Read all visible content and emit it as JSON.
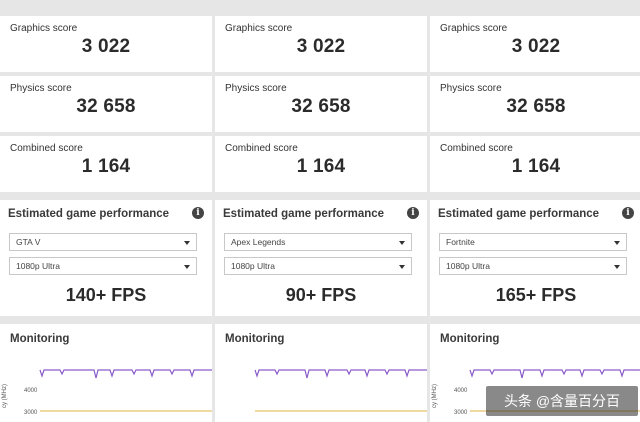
{
  "columns": [
    {
      "graphics": {
        "label": "Graphics score",
        "value": "3 022"
      },
      "physics": {
        "label": "Physics score",
        "value": "32 658"
      },
      "combined": {
        "label": "Combined score",
        "value": "1 164"
      },
      "estimated": {
        "title": "Estimated game performance",
        "game": "GTA V",
        "preset": "1080p Ultra",
        "fps": "140+ FPS"
      },
      "monitoring": {
        "title": "Monitoring"
      }
    },
    {
      "graphics": {
        "label": "Graphics score",
        "value": "3 022"
      },
      "physics": {
        "label": "Physics score",
        "value": "32 658"
      },
      "combined": {
        "label": "Combined score",
        "value": "1 164"
      },
      "estimated": {
        "title": "Estimated game performance",
        "game": "Apex Legends",
        "preset": "1080p Ultra",
        "fps": "90+ FPS"
      },
      "monitoring": {
        "title": "Monitoring"
      }
    },
    {
      "graphics": {
        "label": "Graphics score",
        "value": "3 022"
      },
      "physics": {
        "label": "Physics score",
        "value": "32 658"
      },
      "combined": {
        "label": "Combined score",
        "value": "1 164"
      },
      "estimated": {
        "title": "Estimated game performance",
        "game": "Fortnite",
        "preset": "1080p Ultra",
        "fps": "165+ FPS"
      },
      "monitoring": {
        "title": "Monitoring"
      }
    }
  ],
  "monitoring_axis": {
    "label": "cy (MHz)",
    "ticks": [
      "4000",
      "3000"
    ]
  },
  "colors": {
    "cpu_line": "#8a5cc9",
    "gpu_line": "#e8c46a",
    "background": "#e6e6e6",
    "card": "#ffffff"
  },
  "icons": {
    "info": "info-icon",
    "dropdown": "caret-down-icon"
  },
  "info_glyph": "i",
  "watermark": "头条 @含量百分百"
}
